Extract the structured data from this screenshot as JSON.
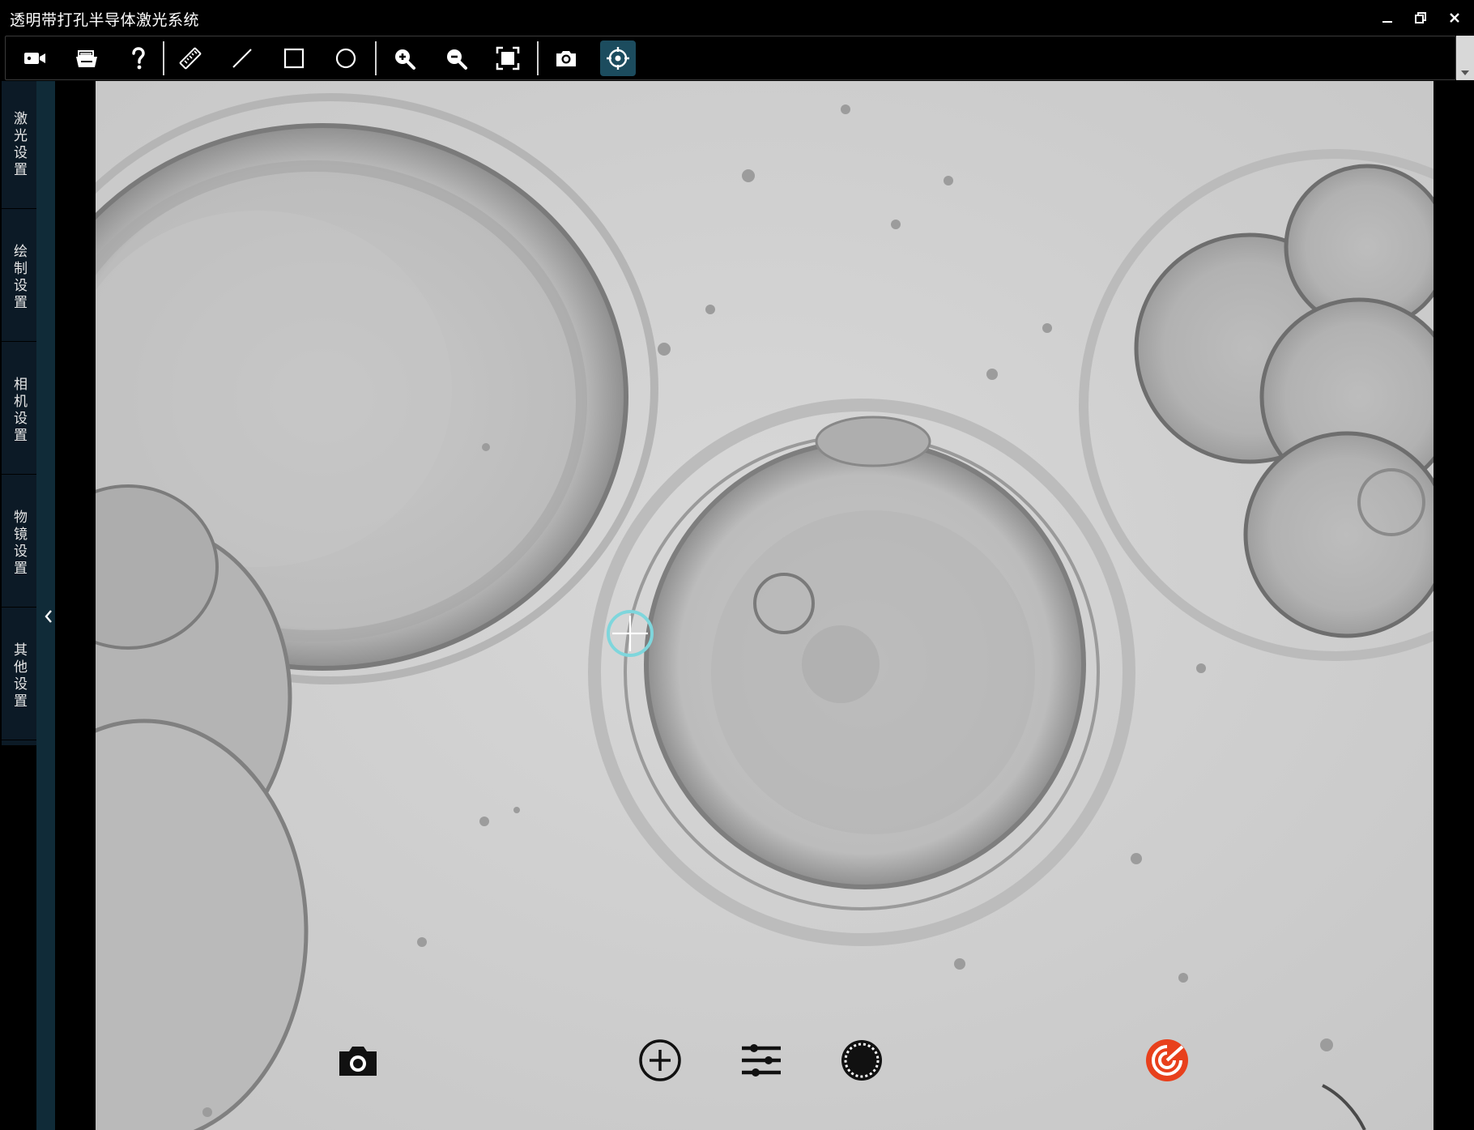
{
  "window": {
    "title": "透明带打孔半导体激光系统"
  },
  "toolbar": {
    "items": [
      {
        "name": "video-camera-icon"
      },
      {
        "name": "open-folder-icon"
      },
      {
        "name": "help-icon"
      },
      {
        "name": "ruler-icon"
      },
      {
        "name": "line-icon"
      },
      {
        "name": "rectangle-icon"
      },
      {
        "name": "circle-icon"
      },
      {
        "name": "zoom-in-icon"
      },
      {
        "name": "zoom-out-icon"
      },
      {
        "name": "fit-screen-icon"
      },
      {
        "name": "snapshot-icon"
      },
      {
        "name": "target-crosshair-icon",
        "active": true
      }
    ]
  },
  "sidebar": {
    "tabs": [
      {
        "label": "激光设置"
      },
      {
        "label": "绘制设置"
      },
      {
        "label": "相机设置"
      },
      {
        "label": "物镜设置"
      },
      {
        "label": "其他设置"
      }
    ]
  },
  "overlay": {
    "buttons": [
      {
        "name": "capture-camera-icon"
      },
      {
        "name": "add-circle-icon"
      },
      {
        "name": "adjust-sliders-icon"
      },
      {
        "name": "pattern-circle-icon"
      },
      {
        "name": "laser-fire-icon",
        "color": "#e8401c"
      }
    ]
  },
  "colors": {
    "accent": "#1c4c5e",
    "laser": "#e8401c",
    "crosshair": "#7fd6dc"
  }
}
